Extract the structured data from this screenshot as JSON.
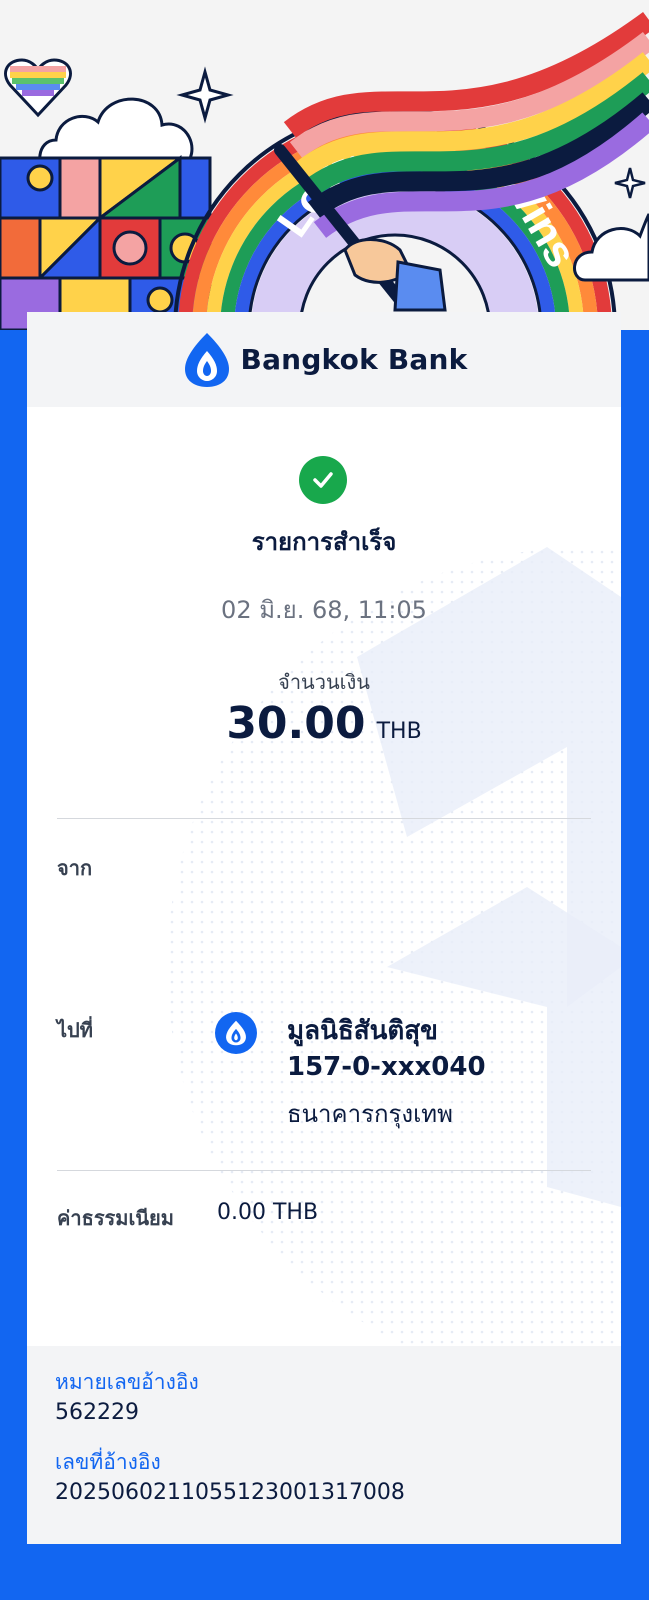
{
  "brand": {
    "name": "Bangkok Bank"
  },
  "banner": {
    "ribbon_text_left": "Love",
    "ribbon_text_right": "Wins"
  },
  "status": {
    "title": "รายการสำเร็จ",
    "datetime": "02 มิ.ย. 68, 11:05"
  },
  "amount": {
    "label": "จำนวนเงิน",
    "value": "30.00",
    "unit": "THB"
  },
  "from": {
    "label": "จาก"
  },
  "to": {
    "label": "ไปที่",
    "name": "มูลนิธิสันติสุข",
    "account": "157-0-xxx040",
    "bank": "ธนาคารกรุงเทพ"
  },
  "fee": {
    "label": "ค่าธรรมเนียม",
    "value": "0.00 THB"
  },
  "reference": {
    "ref1_label": "หมายเลขอ้างอิง",
    "ref1_value": "562229",
    "ref2_label": "เลขที่อ้างอิง",
    "ref2_value": "2025060211055123001317008"
  },
  "colors": {
    "brand_blue": "#1266f1",
    "success_green": "#18a84c",
    "text_dark": "#0b1b3f"
  },
  "icons": {
    "status": "check-icon",
    "brand": "lotus-logo-icon",
    "to_bank": "lotus-bank-icon"
  }
}
